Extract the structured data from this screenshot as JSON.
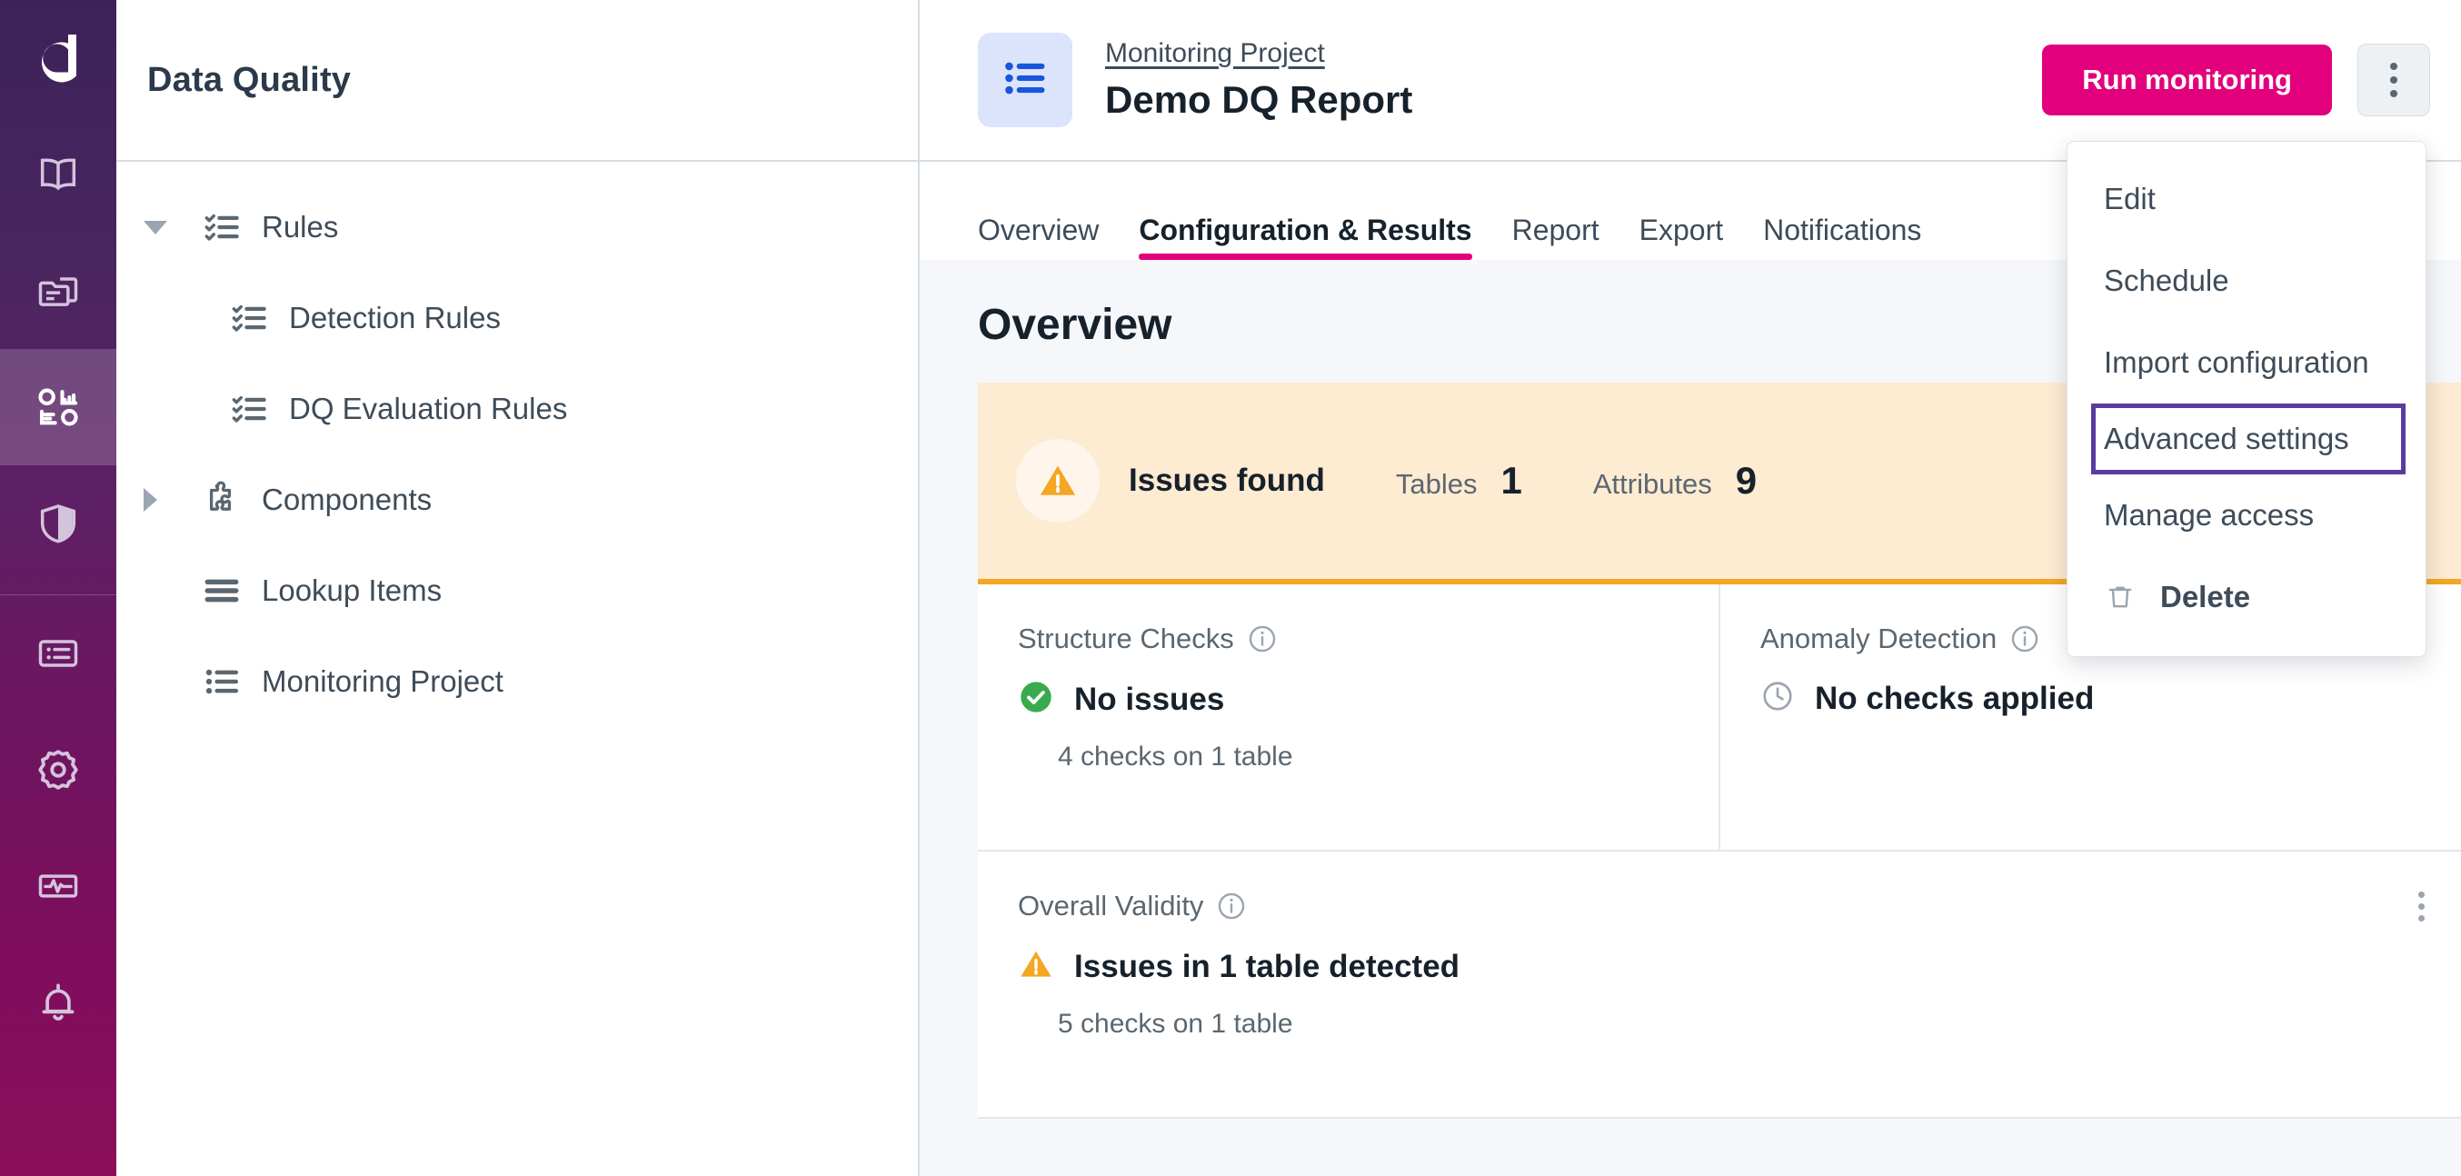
{
  "rail": {
    "logo": "ataccama-logo",
    "items": [
      {
        "name": "book-icon",
        "label": "Knowledge Catalog",
        "active": false
      },
      {
        "name": "folder-document-icon",
        "label": "Sources",
        "active": false
      },
      {
        "name": "data-quality-icon",
        "label": "Data Quality",
        "active": true
      },
      {
        "name": "shield-icon",
        "label": "Governance",
        "active": false
      },
      {
        "name": "list-panel-icon",
        "label": "Tasks",
        "active": false
      },
      {
        "name": "gear-icon",
        "label": "Settings",
        "active": false
      },
      {
        "name": "monitor-pulse-icon",
        "label": "Monitoring",
        "active": false
      },
      {
        "name": "bell-icon",
        "label": "Notifications",
        "active": false
      }
    ]
  },
  "left_panel": {
    "title": "Data Quality",
    "tree": [
      {
        "label": "Rules",
        "icon": "checklist-icon",
        "level": 1,
        "expander": "down"
      },
      {
        "label": "Detection Rules",
        "icon": "checklist-icon",
        "level": 2,
        "expander": "none"
      },
      {
        "label": "DQ Evaluation Rules",
        "icon": "checklist-icon",
        "level": 2,
        "expander": "none"
      },
      {
        "label": "Components",
        "icon": "puzzle-icon",
        "level": 1,
        "expander": "right"
      },
      {
        "label": "Lookup Items",
        "icon": "lines-icon",
        "level": 1,
        "expander": "hidden"
      },
      {
        "label": "Monitoring Project",
        "icon": "bullet-list-icon",
        "level": 1,
        "expander": "hidden"
      }
    ]
  },
  "topbar": {
    "badge_icon": "bullet-list-icon",
    "breadcrumb": "Monitoring Project",
    "title": "Demo DQ Report",
    "run_button": "Run monitoring",
    "kebab_icon": "kebab-menu-icon"
  },
  "tabs": [
    {
      "label": "Overview",
      "active": false
    },
    {
      "label": "Configuration & Results",
      "active": true
    },
    {
      "label": "Report",
      "active": false
    },
    {
      "label": "Export",
      "active": false
    },
    {
      "label": "Notifications",
      "active": false
    }
  ],
  "content": {
    "section_title": "Overview",
    "alert": {
      "icon": "warning-triangle-icon",
      "title": "Issues found",
      "stats": [
        {
          "label": "Tables",
          "value": "1"
        },
        {
          "label": "Attributes",
          "value": "9"
        }
      ]
    },
    "cards": [
      {
        "title": "Structure Checks",
        "info_icon": "info-icon",
        "status_icon": "check-circle-icon",
        "status": "No issues",
        "sub": "4 checks on 1 table",
        "kebab": false
      },
      {
        "title": "Anomaly Detection",
        "info_icon": "info-icon",
        "status_icon": "clock-icon",
        "status": "No checks applied",
        "sub": "",
        "kebab": false
      }
    ],
    "wide_card": {
      "title": "Overall Validity",
      "info_icon": "info-icon",
      "status_icon": "warning-triangle-icon",
      "status": "Issues in 1 table detected",
      "sub": "5 checks on 1 table",
      "kebab_icon": "kebab-menu-icon"
    }
  },
  "dropdown": {
    "items": [
      {
        "label": "Edit",
        "icon": null,
        "focused": false
      },
      {
        "label": "Schedule",
        "icon": null,
        "focused": false
      },
      {
        "label": "Import configuration",
        "icon": null,
        "focused": false
      },
      {
        "label": "Advanced settings",
        "icon": null,
        "focused": true
      },
      {
        "label": "Manage access",
        "icon": null,
        "focused": false
      },
      {
        "label": "Delete",
        "icon": "trash-icon",
        "focused": false
      }
    ]
  },
  "colors": {
    "brand_magenta": "#e2007d",
    "rail_top": "#3d2259",
    "rail_bottom": "#8b0e5a",
    "warning_orange": "#f5a623",
    "alert_bg": "#fdebd2",
    "success_green": "#3aaa4f",
    "focus_purple": "#5b3b9e",
    "page_bg": "#f5f7fa"
  }
}
